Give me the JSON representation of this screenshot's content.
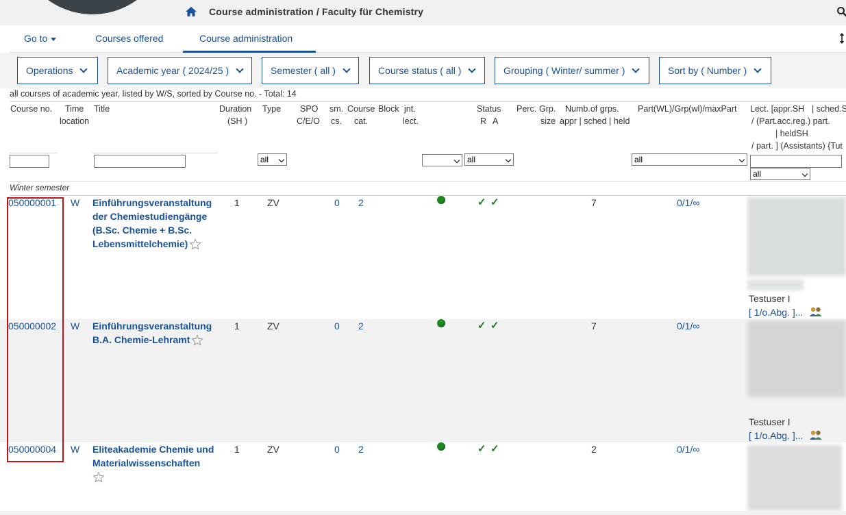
{
  "header": {
    "breadcrumb": "Course administration  / Faculty für Chemistry",
    "home_icon": "home-icon",
    "search_icon": "search-icon"
  },
  "nav": {
    "goto": "Go to",
    "courses_offered": "Courses offered",
    "course_admin": "Course administration",
    "active": "Course administration"
  },
  "toolbar": {
    "operations": "Operations",
    "academic_year": "Academic year ( 2024/25 )",
    "semester": "Semester ( all )",
    "course_status": "Course status ( all )",
    "grouping": "Grouping ( Winter/ summer )",
    "sort_by": "Sort by ( Number )"
  },
  "info_line": "all courses of academic year, listed by W/S, sorted by Course no. - Total: 14",
  "columns": {
    "course_no": "Course no.",
    "time": "Time",
    "location": "location",
    "title": "Title",
    "duration": "Duration",
    "sh": "(SH )",
    "type": "Type",
    "spo": "SPO",
    "ceo": "C/E/O",
    "sm": "sm.",
    "cs": "cs.",
    "course": "Course",
    "cat": "cat.",
    "block": "Block",
    "jnt": "jnt.",
    "lect": "lect.",
    "status": "Status",
    "r": "R",
    "a": "A",
    "perc": "Perc.",
    "grp": "Grp.",
    "size": "size",
    "numb": "Numb.of grps.",
    "appr": "appr | sched | held",
    "part": "Part(WL)/Grp(wl)/maxPart",
    "lect1": "Lect. [appr.SH",
    "sched": "| sched.S",
    "lect2": "/ (Part.acc.reg.) part.",
    "lect3": "| heldSH",
    "lect4": "/ part. ] (Assistants) {Tut"
  },
  "filters": {
    "type_sel": "all",
    "status_a_sel": "all",
    "part_sel": "all",
    "lect_sel": "all"
  },
  "group_label": "Winter semester",
  "rows": [
    {
      "number": "050000001",
      "time": "W",
      "title": "Einführungsveranstaltung der Chemiestudiengänge (B.Sc. Chemie + B.Sc. Lebensmittelchemie)",
      "duration": "1",
      "type": "ZV",
      "sm": "0",
      "cat": "2",
      "groups": "7",
      "part": "0/1/∞",
      "lecturer": "Testuser I",
      "lect_detail": "[ 1/o.Abg. ]..."
    },
    {
      "number": "050000002",
      "time": "W",
      "title": "Einführungsveranstaltung B.A. Chemie-Lehramt",
      "duration": "1",
      "type": "ZV",
      "sm": "0",
      "cat": "2",
      "groups": "7",
      "part": "0/1/∞",
      "lecturer": "Testuser I",
      "lect_detail": "[ 1/o.Abg. ]..."
    },
    {
      "number": "050000004",
      "time": "W",
      "title": "Eliteakademie Chemie und Materialwissenschaften",
      "duration": "1",
      "type": "ZV",
      "sm": "0",
      "cat": "2",
      "groups": "2",
      "part": "0/1/∞"
    }
  ],
  "colors": {
    "link": "#1a5197",
    "highlight": "#c0151b",
    "status_green": "#1e8a1e"
  }
}
